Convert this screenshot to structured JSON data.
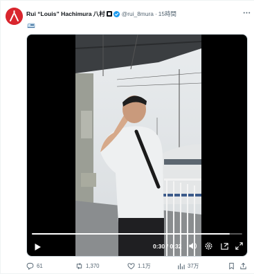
{
  "tweet": {
    "author": {
      "display_name": "Rui “Louis” Hachimura",
      "kanji": "八村",
      "handle": "@rui_8mura",
      "time": "15時間",
      "avatar_icon": "hachimura-logo-icon",
      "verified_color": "#1d9bf0"
    },
    "text_emoji": "train-emoji-icon",
    "video": {
      "progress_fraction": 0.94,
      "timecode": "0:30 / 0:32"
    },
    "actions": {
      "replies": "61",
      "retweets": "1,370",
      "likes": "1.1万",
      "views": "37万"
    }
  },
  "colors": {
    "brand_red": "#d9262e",
    "text_secondary": "#536471",
    "verified_blue": "#1d9bf0"
  }
}
